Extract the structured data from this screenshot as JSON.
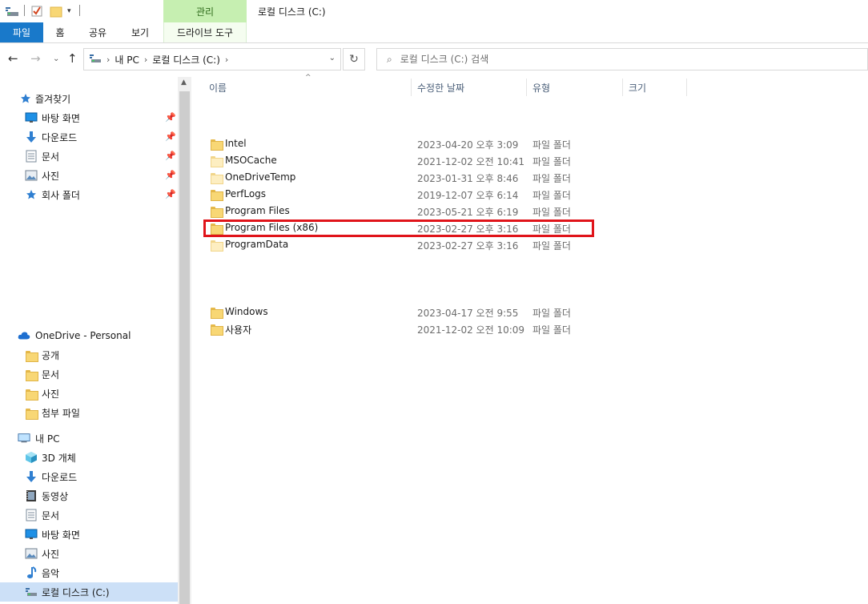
{
  "window": {
    "title": "로컬 디스크 (C:)",
    "contextual_tab": "관리",
    "quick_access_icons": [
      "drive-icon",
      "check-properties-icon",
      "new-folder-icon",
      "customize-arrow-icon"
    ]
  },
  "ribbon": {
    "tabs": [
      {
        "label": "파일"
      },
      {
        "label": "홈"
      },
      {
        "label": "공유"
      },
      {
        "label": "보기"
      },
      {
        "label": "드라이브 도구"
      }
    ]
  },
  "address": {
    "crumbs": [
      "내 PC",
      "로컬 디스크 (C:)"
    ],
    "search_placeholder": "로컬 디스크 (C:) 검색"
  },
  "nav_pane": {
    "quick_access": {
      "label": "즐겨찾기",
      "items": [
        {
          "label": "바탕 화면",
          "icon": "desktop-icon",
          "pinned": true
        },
        {
          "label": "다운로드",
          "icon": "download-icon",
          "pinned": true
        },
        {
          "label": "문서",
          "icon": "documents-icon",
          "pinned": true
        },
        {
          "label": "사진",
          "icon": "pictures-icon",
          "pinned": true
        },
        {
          "label": "회사 폴더",
          "icon": "star-icon",
          "pinned": true
        }
      ]
    },
    "onedrive": {
      "label": "OneDrive - Personal",
      "items": [
        {
          "label": "공개"
        },
        {
          "label": "문서"
        },
        {
          "label": "사진"
        },
        {
          "label": "첨부 파일"
        }
      ]
    },
    "this_pc": {
      "label": "내 PC",
      "items": [
        {
          "label": "3D 개체",
          "icon": "3d-objects-icon"
        },
        {
          "label": "다운로드",
          "icon": "download-icon"
        },
        {
          "label": "동영상",
          "icon": "videos-icon"
        },
        {
          "label": "문서",
          "icon": "documents-icon"
        },
        {
          "label": "바탕 화면",
          "icon": "desktop-icon"
        },
        {
          "label": "사진",
          "icon": "pictures-icon"
        },
        {
          "label": "음악",
          "icon": "music-icon"
        },
        {
          "label": "로컬 디스크 (C:)",
          "icon": "drive-icon",
          "selected": true
        }
      ]
    }
  },
  "columns": {
    "name": "이름",
    "date": "수정한 날짜",
    "type": "유형",
    "size": "크기"
  },
  "files": [
    {
      "name": "Intel",
      "date": "2023-04-20 오후 3:09",
      "type": "파일 폴더",
      "pale": false
    },
    {
      "name": "MSOCache",
      "date": "2021-12-02 오전 10:41",
      "type": "파일 폴더",
      "pale": true
    },
    {
      "name": "OneDriveTemp",
      "date": "2023-01-31 오후 8:46",
      "type": "파일 폴더",
      "pale": true
    },
    {
      "name": "PerfLogs",
      "date": "2019-12-07 오후 6:14",
      "type": "파일 폴더",
      "pale": false
    },
    {
      "name": "Program Files",
      "date": "2023-05-21 오후 6:19",
      "type": "파일 폴더",
      "pale": false
    },
    {
      "name": "Program Files (x86)",
      "date": "2023-02-27 오후 3:16",
      "type": "파일 폴더",
      "pale": false
    },
    {
      "name": "ProgramData",
      "date": "2023-02-27 오후 3:16",
      "type": "파일 폴더",
      "pale": true
    },
    {
      "name": "Windows",
      "date": "2023-04-17 오전 9:55",
      "type": "파일 폴더",
      "pale": false
    },
    {
      "name": "사용자",
      "date": "2021-12-02 오전 10:09",
      "type": "파일 폴더",
      "pale": false
    }
  ],
  "highlight_color": "#e0141a"
}
